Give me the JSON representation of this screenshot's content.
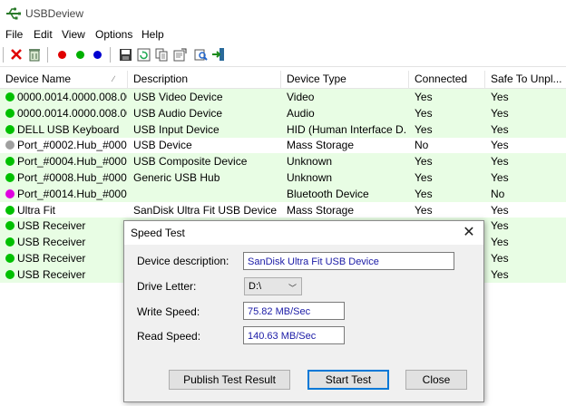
{
  "app": {
    "title": "USBDeview"
  },
  "menu": [
    "File",
    "Edit",
    "View",
    "Options",
    "Help"
  ],
  "toolbar": {
    "icons": [
      "delete-icon",
      "uninstall-icon",
      "red-dot-icon",
      "green-dot-icon",
      "blue-dot-icon",
      "save-icon",
      "refresh-icon",
      "copy-icon",
      "properties-icon",
      "find-icon",
      "exit-icon"
    ]
  },
  "columns": [
    "Device Name",
    "Description",
    "Device Type",
    "Connected",
    "Safe To Unpl..."
  ],
  "status_colors": {
    "green": "#00c000",
    "gray": "#a0a0a0",
    "magenta": "#e000e0"
  },
  "rows": [
    {
      "name": "0000.0014.0000.008.00...",
      "description": "USB Video Device",
      "type": "Video",
      "connected": "Yes",
      "safe": "Yes",
      "status": "green",
      "highlight": true
    },
    {
      "name": "0000.0014.0000.008.00...",
      "description": "USB Audio Device",
      "type": "Audio",
      "connected": "Yes",
      "safe": "Yes",
      "status": "green",
      "highlight": true
    },
    {
      "name": "DELL USB Keyboard",
      "description": "USB Input Device",
      "type": "HID (Human Interface D...",
      "connected": "Yes",
      "safe": "Yes",
      "status": "green",
      "highlight": true
    },
    {
      "name": "Port_#0002.Hub_#0001",
      "description": "USB Device",
      "type": "Mass Storage",
      "connected": "No",
      "safe": "Yes",
      "status": "gray",
      "highlight": false
    },
    {
      "name": "Port_#0004.Hub_#0002",
      "description": "USB Composite Device",
      "type": "Unknown",
      "connected": "Yes",
      "safe": "Yes",
      "status": "green",
      "highlight": true
    },
    {
      "name": "Port_#0008.Hub_#0001",
      "description": "Generic USB Hub",
      "type": "Unknown",
      "connected": "Yes",
      "safe": "Yes",
      "status": "green",
      "highlight": true
    },
    {
      "name": "Port_#0014.Hub_#0001",
      "description": "",
      "type": "Bluetooth Device",
      "connected": "Yes",
      "safe": "No",
      "status": "magenta",
      "highlight": true
    },
    {
      "name": "Ultra Fit",
      "description": "SanDisk Ultra Fit USB Device",
      "type": "Mass Storage",
      "connected": "Yes",
      "safe": "Yes",
      "status": "green",
      "highlight": false
    },
    {
      "name": "USB Receiver",
      "description": "",
      "type": "",
      "connected": "",
      "safe": "Yes",
      "status": "green",
      "highlight": true
    },
    {
      "name": "USB Receiver",
      "description": "",
      "type": "",
      "connected": "",
      "safe": "Yes",
      "status": "green",
      "highlight": true
    },
    {
      "name": "USB Receiver",
      "description": "",
      "type": "",
      "connected": "",
      "safe": "Yes",
      "status": "green",
      "highlight": true
    },
    {
      "name": "USB Receiver",
      "description": "",
      "type": "",
      "connected": "",
      "safe": "Yes",
      "status": "green",
      "highlight": true
    }
  ],
  "dialog": {
    "title": "Speed Test",
    "device_label": "Device description:",
    "device_value": "SanDisk Ultra Fit USB Device",
    "drive_label": "Drive Letter:",
    "drive_value": "D:\\",
    "write_label": "Write Speed:",
    "write_value": "75.82  MB/Sec",
    "read_label": "Read Speed:",
    "read_value": "140.63  MB/Sec",
    "publish_button": "Publish Test Result",
    "start_button": "Start Test",
    "close_button": "Close"
  }
}
